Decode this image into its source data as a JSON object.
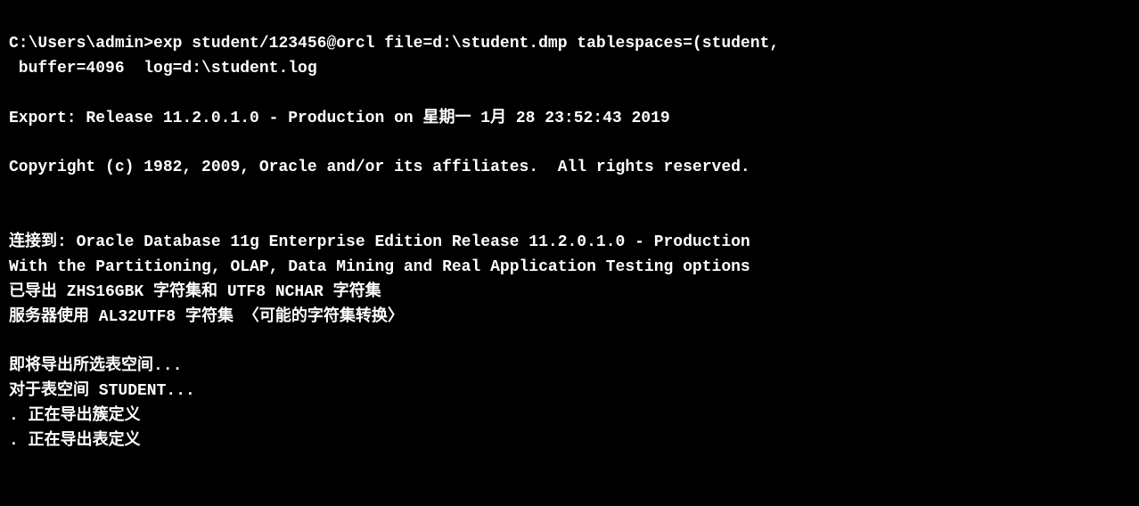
{
  "terminal": {
    "lines": [
      {
        "id": "cmd-line1",
        "text": "C:\\Users\\admin>exp student/123456@orcl file=d:\\student.dmp tablespaces=(student,"
      },
      {
        "id": "cmd-line2",
        "text": " buffer=4096  log=d:\\student.log"
      },
      {
        "id": "empty1",
        "text": ""
      },
      {
        "id": "export-line",
        "text": "Export: Release 11.2.0.1.0 - Production on 星期一 1月 28 23:52:43 2019"
      },
      {
        "id": "empty2",
        "text": ""
      },
      {
        "id": "copyright-line",
        "text": "Copyright (c) 1982, 2009, Oracle and/or its affiliates.  All rights reserved."
      },
      {
        "id": "empty3",
        "text": ""
      },
      {
        "id": "empty4",
        "text": ""
      },
      {
        "id": "connect-line1",
        "text": "连接到: Oracle Database 11g Enterprise Edition Release 11.2.0.1.0 - Production"
      },
      {
        "id": "connect-line2",
        "text": "With the Partitioning, OLAP, Data Mining and Real Application Testing options"
      },
      {
        "id": "charset-line1",
        "text": "已导出 ZHS16GBK 字符集和 UTF8 NCHAR 字符集"
      },
      {
        "id": "charset-line2",
        "text": "服务器使用 AL32UTF8 字符集 〈可能的字符集转换〉"
      },
      {
        "id": "empty5",
        "text": ""
      },
      {
        "id": "export-ts-line",
        "text": "即将导出所选表空间..."
      },
      {
        "id": "ts-student-line",
        "text": "对于表空间 STUDENT..."
      },
      {
        "id": "cluster-def-line",
        "text": ". 正在导出簇定义"
      },
      {
        "id": "table-def-line",
        "text": ". 正在导出表定义"
      }
    ]
  }
}
